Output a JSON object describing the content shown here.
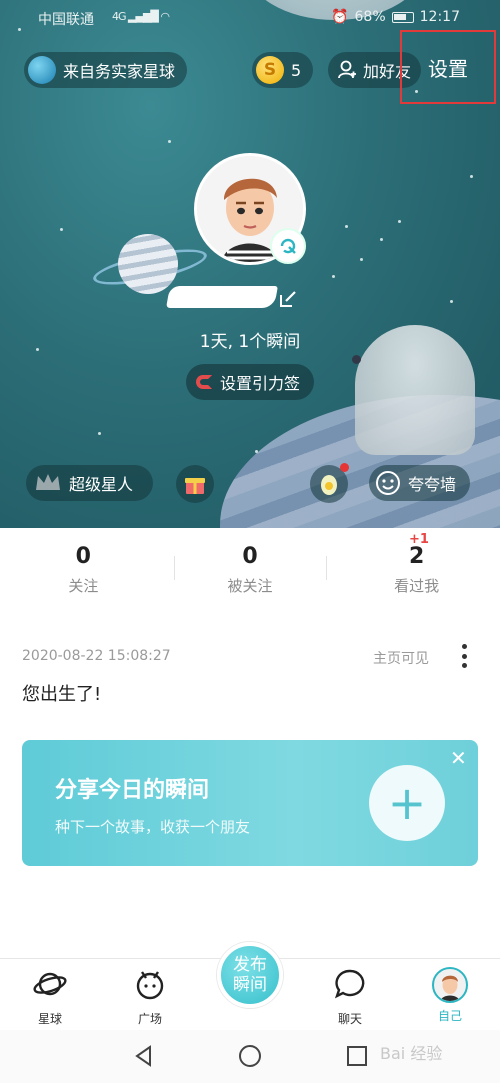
{
  "status_bar": {
    "carrier": "中国联通",
    "signal_tag": "4G",
    "battery": "68%",
    "time": "12:17"
  },
  "header": {
    "planet_label": "来自务实家星球",
    "coins": "5",
    "add_friend_label": "加好友",
    "settings_label": "设置"
  },
  "profile": {
    "days_text": "1天, 1个瞬间",
    "gravity_tag_label": "设置引力签"
  },
  "actions": {
    "super_star_label": "超级星人",
    "praise_wall_label": "夸夸墙"
  },
  "stats": [
    {
      "value": "0",
      "label": "关注"
    },
    {
      "value": "0",
      "label": "被关注"
    },
    {
      "value": "2",
      "label": "看过我",
      "badge": "+1"
    }
  ],
  "moment": {
    "date": "2020-08-22 15:08:27",
    "visibility": "主页可见",
    "text": "您出生了!"
  },
  "share_card": {
    "title": "分享今日的瞬间",
    "subtitle": "种下一个故事，收获一个朋友",
    "plus": "+",
    "close": "✕"
  },
  "tabbar": {
    "items": [
      {
        "label": "星球",
        "icon": "planet-icon"
      },
      {
        "label": "广场",
        "icon": "square-icon"
      },
      {
        "label": "聊天",
        "icon": "chat-icon"
      },
      {
        "label": "自己",
        "icon": "me-avatar"
      }
    ],
    "publish_line1": "发布",
    "publish_line2": "瞬间"
  },
  "watermark": "Bai 经验",
  "colors": {
    "accent": "#2cb6c3",
    "highlight_box": "#e23a3a",
    "hero_bg": "#2c6e77"
  }
}
